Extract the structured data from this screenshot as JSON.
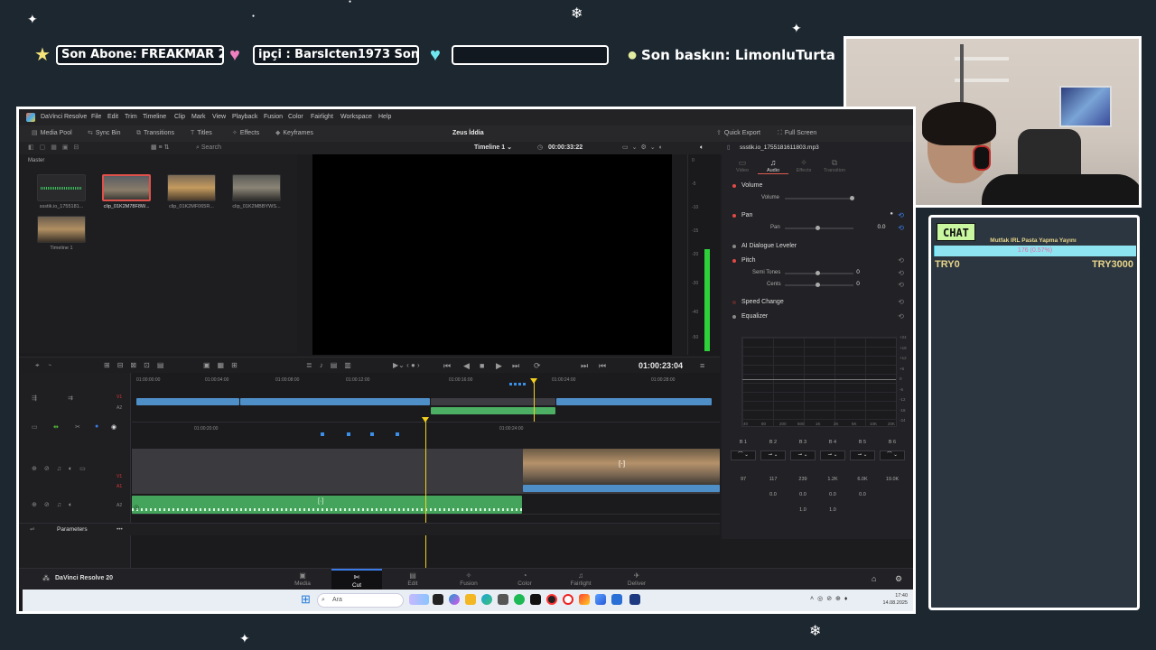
{
  "overlay": {
    "last_sub": "Son Abone: FREAKMAR 2",
    "last_donor": "ipçi : BarsIcten1973    Son T",
    "last_raid": "Son baskın: LimonluTurta",
    "empty_box": ""
  },
  "chat": {
    "badge": "CHAT",
    "goal_title": "Mutfak IRL Pasta Yapma Yayını",
    "goal_text": "176 (0.57%)",
    "goal_fraction": 0.0057,
    "goal_min": "TRY0",
    "goal_max": "TRY3000"
  },
  "resolve": {
    "menu": [
      "DaVinci Resolve",
      "File",
      "Edit",
      "Trim",
      "Timeline",
      "Clip",
      "Mark",
      "View",
      "Playback",
      "Fusion",
      "Color",
      "Fairlight",
      "Workspace",
      "Help"
    ],
    "toolbar": {
      "media_pool": "Media Pool",
      "sync_bin": "Sync Bin",
      "transitions": "Transitions",
      "titles": "Titles",
      "effects": "Effects",
      "keyframes": "Keyframes",
      "project_title": "Zeus İddia",
      "quick_export": "Quick Export",
      "full_screen": "Full Screen"
    },
    "subbar": {
      "search": "Search",
      "timeline_name": "Timeline 1",
      "duration": "00:00:33:22"
    },
    "pool": {
      "label": "Master",
      "clips": [
        {
          "name": "ssstik.io_1755181...",
          "kind": "audio"
        },
        {
          "name": "clip_01K2M78F8W...",
          "kind": "video"
        },
        {
          "name": "clip_01K2MF065R...",
          "kind": "video"
        },
        {
          "name": "clip_01K2MBBYWS...",
          "kind": "video"
        },
        {
          "name": "Timeline 1",
          "kind": "timeline"
        }
      ]
    },
    "meter_ticks": [
      "0",
      "-5",
      "-10",
      "-15",
      "-20",
      "-30",
      "-40",
      "-50"
    ],
    "meter_level": 0.53,
    "inspector": {
      "file": "ssstik.io_1755181611803.mp3",
      "tabs": [
        "Video",
        "Audio",
        "Effects",
        "Transition"
      ],
      "volume": {
        "title": "Volume",
        "param": "Volume"
      },
      "pan": {
        "title": "Pan",
        "param": "Pan",
        "value": "0.0"
      },
      "ai_dialogue": "AI Dialogue Leveler",
      "pitch": {
        "title": "Pitch",
        "semi_label": "Semi Tones",
        "semi_value": "0",
        "cents_label": "Cents",
        "cents_value": "0"
      },
      "speed_change": "Speed Change",
      "equalizer": "Equalizer",
      "eq_y_ticks": [
        "+24",
        "+18",
        "+12",
        "+6",
        "0",
        "-6",
        "-12",
        "-18",
        "-24"
      ],
      "eq_x_ticks": [
        "40",
        "80",
        "200",
        "500",
        "1K",
        "2K",
        "5K",
        "10K",
        "20K"
      ],
      "bands": [
        {
          "label": "B 1",
          "freq": "97",
          "gain": "",
          "q": ""
        },
        {
          "label": "B 2",
          "freq": "117",
          "gain": "0.0",
          "q": ""
        },
        {
          "label": "B 3",
          "freq": "239",
          "gain": "0.0",
          "q": "1.0"
        },
        {
          "label": "B 4",
          "freq": "1.2K",
          "gain": "0.0",
          "q": "1.0"
        },
        {
          "label": "B 5",
          "freq": "6.0K",
          "gain": "0.0",
          "q": ""
        },
        {
          "label": "B 6",
          "freq": "19.0K",
          "gain": "",
          "q": ""
        }
      ]
    },
    "timecode": "01:00:23:04",
    "ruler_top": [
      "01:00:00:00",
      "01:00:04:00",
      "01:00:08:00",
      "01:00:12:00",
      "01:00:16:00",
      "01:00:20:00",
      "01:00:24:00",
      "01:00:28:00"
    ],
    "ruler_bottom": [
      "01:00:20:00",
      "01:00:24:00"
    ],
    "tracks": [
      "V1",
      "A2",
      "V1",
      "A1",
      "A2"
    ],
    "parameters": "Parameters",
    "brand": "DaVinci Resolve 20",
    "pages": [
      "Media",
      "Cut",
      "Edit",
      "Fusion",
      "Color",
      "Fairlight",
      "Deliver"
    ],
    "active_page": "Cut"
  },
  "taskbar": {
    "search": "Ara",
    "time": "17:40",
    "date": "14.08.2025"
  }
}
